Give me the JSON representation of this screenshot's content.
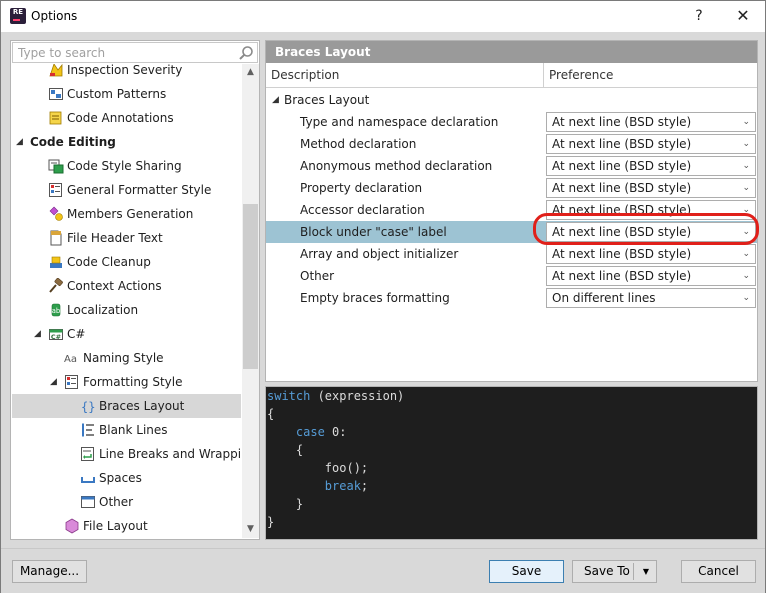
{
  "window": {
    "title": "Options",
    "icon_text": "RE",
    "help_label": "?",
    "close_label": "✕"
  },
  "search": {
    "placeholder": "Type to search"
  },
  "tree": [
    {
      "label": "Inspection Severity",
      "icon": "inspection-severity-icon"
    },
    {
      "label": "Custom Patterns",
      "icon": "custom-patterns-icon"
    },
    {
      "label": "Code Annotations",
      "icon": "code-annotations-icon"
    },
    {
      "label": "Code Editing",
      "icon": "",
      "bold": true,
      "expanded": true
    },
    {
      "label": "Code Style Sharing",
      "icon": "code-style-sharing-icon"
    },
    {
      "label": "General Formatter Style",
      "icon": "general-formatter-icon"
    },
    {
      "label": "Members Generation",
      "icon": "members-generation-icon"
    },
    {
      "label": "File Header Text",
      "icon": "file-header-icon"
    },
    {
      "label": "Code Cleanup",
      "icon": "code-cleanup-icon"
    },
    {
      "label": "Context Actions",
      "icon": "context-actions-icon"
    },
    {
      "label": "Localization",
      "icon": "localization-icon"
    },
    {
      "label": "C#",
      "icon": "csharp-icon",
      "expanded": true
    },
    {
      "label": "Naming Style",
      "icon": "naming-style-icon"
    },
    {
      "label": "Formatting Style",
      "icon": "formatting-style-icon",
      "expanded": true
    },
    {
      "label": "Braces Layout",
      "icon": "braces-layout-icon",
      "selected": true
    },
    {
      "label": "Blank Lines",
      "icon": "blank-lines-icon"
    },
    {
      "label": "Line Breaks and Wrapping",
      "icon": "line-breaks-icon"
    },
    {
      "label": "Spaces",
      "icon": "spaces-icon"
    },
    {
      "label": "Other",
      "icon": "other-icon"
    },
    {
      "label": "File Layout",
      "icon": "file-layout-icon"
    }
  ],
  "panel": {
    "header": "Braces Layout",
    "col_description": "Description",
    "col_preference": "Preference",
    "group_label": "Braces Layout",
    "rows": [
      {
        "label": "Type and namespace declaration",
        "value": "At next line (BSD style)"
      },
      {
        "label": "Method declaration",
        "value": "At next line (BSD style)"
      },
      {
        "label": "Anonymous method declaration",
        "value": "At next line (BSD style)"
      },
      {
        "label": "Property declaration",
        "value": "At next line (BSD style)"
      },
      {
        "label": "Accessor declaration",
        "value": "At next line (BSD style)"
      },
      {
        "label": "Block under \"case\" label",
        "value": "At next line (BSD style)",
        "highlight": true
      },
      {
        "label": "Array and object initializer",
        "value": "At next line (BSD style)"
      },
      {
        "label": "Other",
        "value": "At next line (BSD style)"
      },
      {
        "label": "Empty braces formatting",
        "value": "On different lines"
      }
    ]
  },
  "code": {
    "line1_kw": "switch",
    "line1_rest": " (expression)",
    "line2": "{",
    "line3_indent": "    ",
    "line3_kw": "case",
    "line3_rest": " 0:",
    "line4": "    {",
    "line5": "        foo();",
    "line6_indent": "        ",
    "line6_kw": "break",
    "line6_rest": ";",
    "line7": "    }",
    "line8": "}"
  },
  "buttons": {
    "manage": "Manage...",
    "save": "Save",
    "save_to": "Save To",
    "cancel": "Cancel"
  },
  "colors": {
    "highlight_row": "#9dc3d3",
    "selected_tree": "#d7d7d7",
    "keyword": "#569cd6",
    "annotation": "#e0201a"
  }
}
